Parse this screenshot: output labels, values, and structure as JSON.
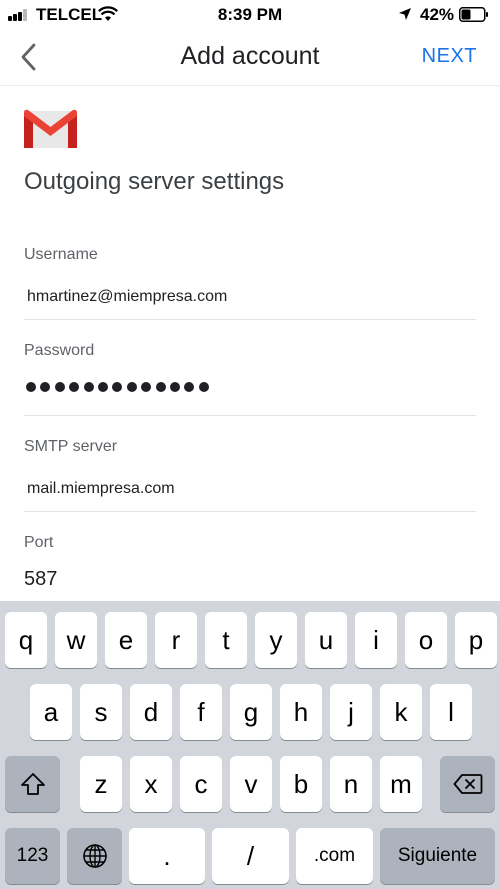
{
  "status_bar": {
    "carrier": "TELCEL",
    "time": "8:39 PM",
    "battery_percent": "42%",
    "battery_level": 0.42
  },
  "app_bar": {
    "title": "Add account",
    "next_label": "NEXT"
  },
  "page": {
    "heading": "Outgoing server settings"
  },
  "fields": {
    "username": {
      "label": "Username",
      "value": "hmartinez@miempresa.com"
    },
    "password": {
      "label": "Password",
      "dot_count": 13
    },
    "smtp_server": {
      "label": "SMTP server",
      "value": "mail.miempresa.com"
    },
    "port": {
      "label": "Port",
      "value": "587"
    }
  },
  "keyboard": {
    "row1": [
      "q",
      "w",
      "e",
      "r",
      "t",
      "y",
      "u",
      "i",
      "o",
      "p"
    ],
    "row2": [
      "a",
      "s",
      "d",
      "f",
      "g",
      "h",
      "j",
      "k",
      "l"
    ],
    "row3": [
      "z",
      "x",
      "c",
      "v",
      "b",
      "n",
      "m"
    ],
    "numbers_key": "123",
    "period_key": ".",
    "slash_key": "/",
    "dotcom_key": ".com",
    "return_key": "Siguiente"
  },
  "colors": {
    "accent": "#1a73e8",
    "keyboard_bg": "#d2d5db",
    "gmail_red": "#ea4335"
  },
  "icons": [
    "signal-icon",
    "wifi-icon",
    "location-arrow-icon",
    "battery-icon",
    "back-arrow-icon",
    "gmail-logo",
    "shift-icon",
    "backspace-icon",
    "globe-icon"
  ]
}
